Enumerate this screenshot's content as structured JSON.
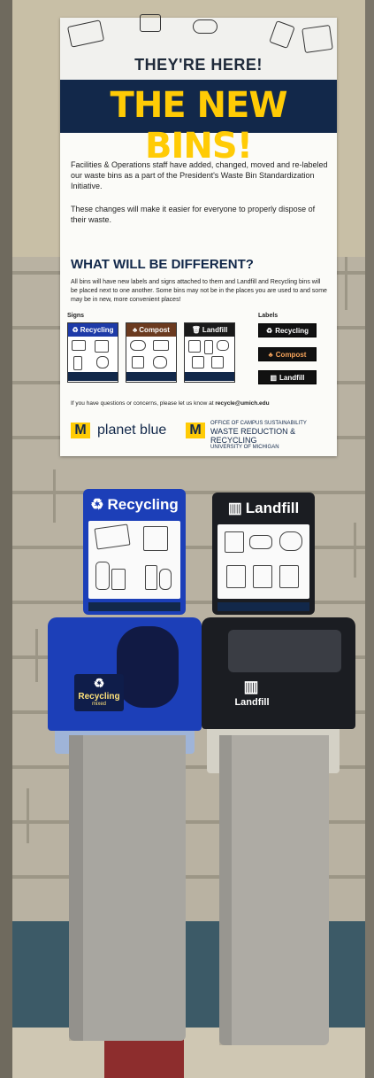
{
  "poster": {
    "kicker": "THEY'RE HERE!",
    "headline": "THE NEW BINS!",
    "paragraph1": "Facilities & Operations staff have added, changed, moved and re-labeled our waste bins as a part of the President's Waste Bin Standardization Initiative.",
    "paragraph2": "These changes will make it easier for everyone to properly dispose of their waste.",
    "subhead": "WHAT WILL BE DIFFERENT?",
    "paragraph3": "All bins will have new labels and signs attached to them and Landfill and Recycling bins will be placed next to one another. Some bins may not be in the places you are used to and some may be in new, more convenient places!",
    "signs_label": "Signs",
    "labels_label": "Labels",
    "signs": [
      {
        "title": "Recycling",
        "color": "#1d3aa8"
      },
      {
        "title": "Compost",
        "color": "#6b3a1f"
      },
      {
        "title": "Landfill",
        "color": "#1a1a1a"
      }
    ],
    "label_tags": [
      "Recycling",
      "Compost",
      "Landfill"
    ],
    "contact_prefix": "If you have questions or concerns, please let us know at",
    "contact_email": "recycle@umich.edu",
    "logo_left": "planet blue",
    "logo_m": "M",
    "logo_right_small": "OFFICE OF CAMPUS SUSTAINABILITY",
    "logo_right_big": "WASTE REDUCTION & RECYCLING",
    "logo_right_sub": "UNIVERSITY OF MICHIGAN"
  },
  "bins": {
    "recycling": {
      "sign_title": "Recycling",
      "sign_subtitle": "mixed",
      "lid_label": "Recycling",
      "lid_sublabel": "mixed",
      "color": "#1c3fb8"
    },
    "landfill": {
      "sign_title": "Landfill",
      "lid_label": "Landfill",
      "color": "#1b1d22"
    }
  },
  "colors": {
    "umich_blue": "#12284a",
    "maize": "#ffcb05"
  }
}
